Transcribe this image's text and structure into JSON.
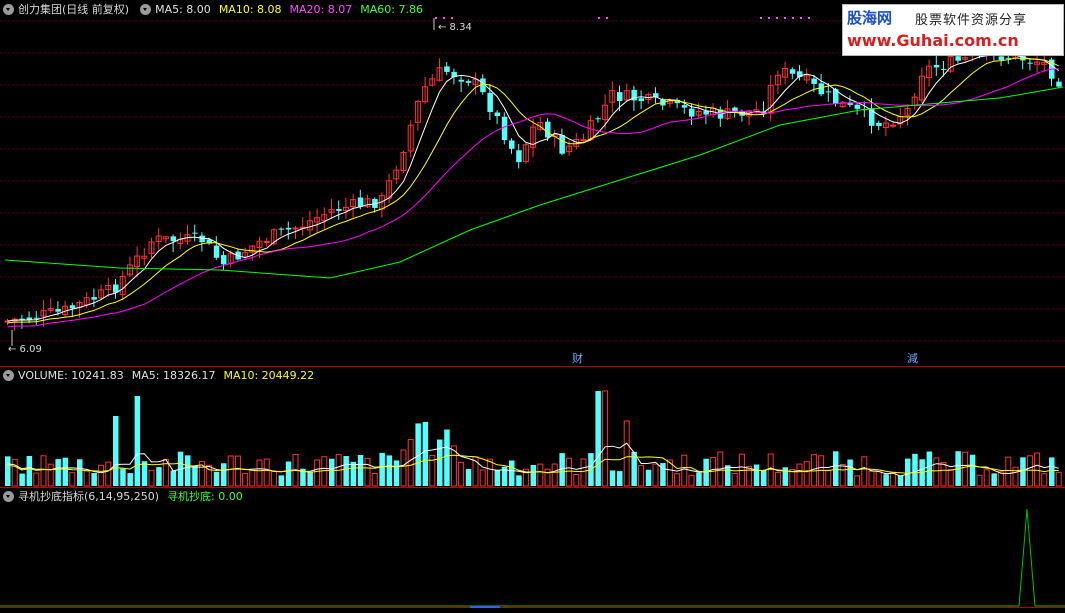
{
  "price_panel": {
    "title": "创力集团(日线 前复权)",
    "ma5": "MA5: 8.00",
    "ma10": "MA10: 8.08",
    "ma20": "MA20: 8.07",
    "ma60": "MA60: 7.86",
    "high_marker": "8.34",
    "low_marker": "6.09",
    "event_marker_1": "财",
    "event_marker_2": "減"
  },
  "volume_panel": {
    "title": "VOLUME: 10241.83",
    "ma5": "MA5: 18326.17",
    "ma10": "MA10: 20449.22"
  },
  "indicator_panel": {
    "title": "寻机抄底指标(6,14,95,250)",
    "value": "寻机抄底: 0.00"
  },
  "watermark": {
    "brand": "股海网",
    "slogan": "股票软件资源分享",
    "url": "www.Guhai.com.cn"
  },
  "colors": {
    "up": "#ff3232",
    "down": "#54ffff",
    "ma5": "#ffffff",
    "ma10": "#ffff00",
    "ma20": "#ff00ff",
    "ma60": "#00ff00",
    "grid": "#5a0000",
    "divider": "#b00000",
    "label_ma5": "#e0e0e0",
    "label_ma20": "#ff4cff",
    "label_ma60": "#3cff3c",
    "indicator": "#00c000"
  }
}
